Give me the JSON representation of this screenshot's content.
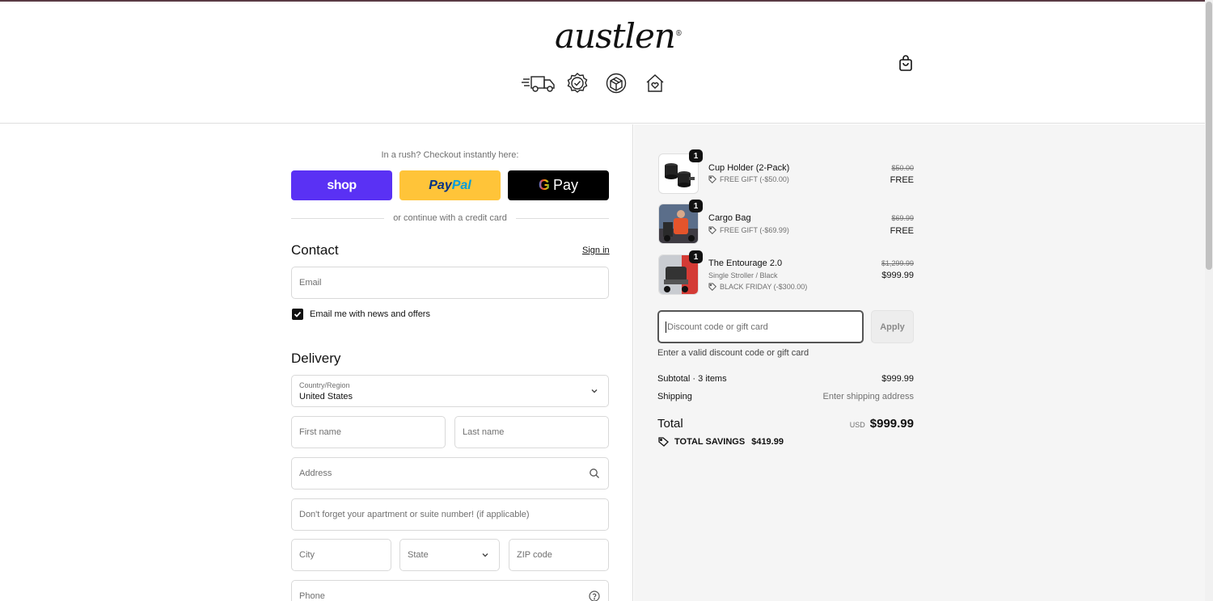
{
  "brand": {
    "logo": "austlen",
    "trademark": "®"
  },
  "header": {
    "icons": [
      "fast-delivery-truck-icon",
      "verified-badge-icon",
      "returns-box-icon",
      "home-heart-icon"
    ],
    "cart_icon": "shopping-bag-icon"
  },
  "express": {
    "prompt": "In a rush? Checkout instantly here:",
    "shop_label": "shop",
    "paypal_label_pay": "Pay",
    "paypal_label_pal": "Pal",
    "gpay_g": "G",
    "gpay_label": "Pay",
    "divider": "or continue with a credit card"
  },
  "contact": {
    "heading": "Contact",
    "sign_in": "Sign in",
    "email_placeholder": "Email",
    "newsletter_label": "Email me with news and offers",
    "newsletter_checked": true
  },
  "delivery": {
    "heading": "Delivery",
    "country_label": "Country/Region",
    "country_value": "United States",
    "first_name_placeholder": "First name",
    "last_name_placeholder": "Last name",
    "address_placeholder": "Address",
    "apartment_placeholder": "Don't forget your apartment or suite number! (if applicable)",
    "city_placeholder": "City",
    "state_placeholder": "State",
    "zip_placeholder": "ZIP code",
    "phone_placeholder": "Phone"
  },
  "summary": {
    "items": [
      {
        "name": "Cup Holder (2-Pack)",
        "variant": "",
        "qty": "1",
        "discount": "FREE GIFT (-$50.00)",
        "old_price": "$50.00",
        "price": "FREE"
      },
      {
        "name": "Cargo Bag",
        "variant": "",
        "qty": "1",
        "discount": "FREE GIFT (-$69.99)",
        "old_price": "$69.99",
        "price": "FREE"
      },
      {
        "name": "The Entourage 2.0",
        "variant": "Single Stroller / Black",
        "qty": "1",
        "discount": "BLACK FRIDAY (-$300.00)",
        "old_price": "$1,299.99",
        "price": "$999.99"
      }
    ],
    "discount_placeholder": "Discount code or gift card",
    "apply_label": "Apply",
    "error": "Enter a valid discount code or gift card",
    "subtotal_label": "Subtotal · 3 items",
    "subtotal_value": "$999.99",
    "shipping_label": "Shipping",
    "shipping_value": "Enter shipping address",
    "total_label": "Total",
    "currency": "USD",
    "total_value": "$999.99",
    "savings_label": "TOTAL SAVINGS",
    "savings_value": "$419.99"
  },
  "colors": {
    "shop": "#5a31f4",
    "paypal": "#ffc439",
    "gpay": "#000000",
    "summary_bg": "#f5f5f5"
  }
}
